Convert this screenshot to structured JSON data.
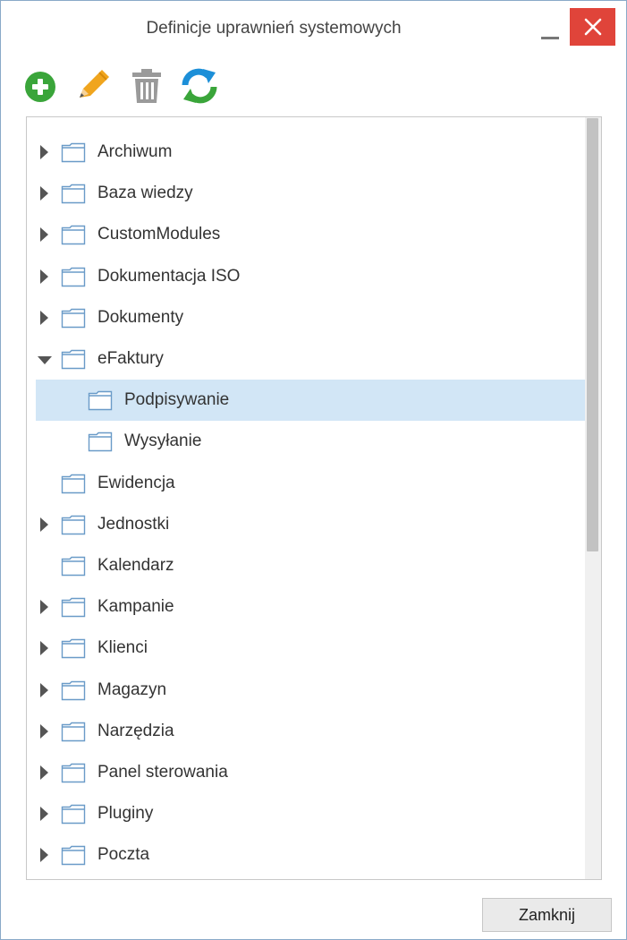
{
  "window": {
    "title": "Definicje uprawnień systemowych",
    "close_glyph": "✕"
  },
  "toolbar": {
    "items": [
      {
        "name": "add",
        "icon": "plus-circle-icon",
        "color": "#3aa53a"
      },
      {
        "name": "edit",
        "icon": "pencil-icon",
        "color": "#f0a51e"
      },
      {
        "name": "delete",
        "icon": "trash-icon",
        "color": "#9a9a9a"
      },
      {
        "name": "refresh",
        "icon": "refresh-icon",
        "color": "#1c8fd8"
      }
    ]
  },
  "tree": {
    "items": [
      {
        "label": "Archiwum",
        "level": 0,
        "toggle": "collapsed"
      },
      {
        "label": "Baza wiedzy",
        "level": 0,
        "toggle": "collapsed"
      },
      {
        "label": "CustomModules",
        "level": 0,
        "toggle": "collapsed"
      },
      {
        "label": "Dokumentacja ISO",
        "level": 0,
        "toggle": "collapsed"
      },
      {
        "label": "Dokumenty",
        "level": 0,
        "toggle": "collapsed"
      },
      {
        "label": "eFaktury",
        "level": 0,
        "toggle": "expanded"
      },
      {
        "label": "Podpisywanie",
        "level": 1,
        "toggle": "none",
        "selected": true
      },
      {
        "label": "Wysyłanie",
        "level": 1,
        "toggle": "none"
      },
      {
        "label": "Ewidencja",
        "level": 0,
        "toggle": "none"
      },
      {
        "label": "Jednostki",
        "level": 0,
        "toggle": "collapsed"
      },
      {
        "label": "Kalendarz",
        "level": 0,
        "toggle": "none"
      },
      {
        "label": "Kampanie",
        "level": 0,
        "toggle": "collapsed"
      },
      {
        "label": "Klienci",
        "level": 0,
        "toggle": "collapsed"
      },
      {
        "label": "Magazyn",
        "level": 0,
        "toggle": "collapsed"
      },
      {
        "label": "Narzędzia",
        "level": 0,
        "toggle": "collapsed"
      },
      {
        "label": "Panel sterowania",
        "level": 0,
        "toggle": "collapsed"
      },
      {
        "label": "Pluginy",
        "level": 0,
        "toggle": "collapsed"
      },
      {
        "label": "Poczta",
        "level": 0,
        "toggle": "collapsed"
      }
    ]
  },
  "footer": {
    "close_label": "Zamknij"
  }
}
